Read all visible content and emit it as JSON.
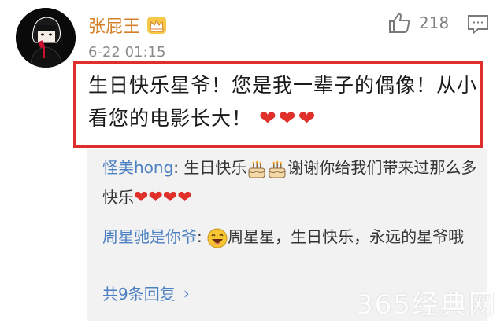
{
  "comment": {
    "username": "张屁王",
    "timestamp": "6-22 01:15",
    "like_count": "218",
    "text": "生日快乐星爷！您是我一辈子的偶像！从小看您的电影长大！",
    "hearts": [
      "❤",
      "❤",
      "❤"
    ]
  },
  "replies": [
    {
      "user": "怪美hong",
      "sep": ": ",
      "text_before": "生日快乐",
      "text_after": "谢谢你给我们带来过那么多快乐",
      "hearts": [
        "❤",
        "❤",
        "❤",
        "❤"
      ]
    },
    {
      "user": "周星驰是你爷",
      "sep": ": ",
      "text": "周星星，生日快乐，永远的星爷哦"
    }
  ],
  "more_replies": {
    "label": "共9条回复",
    "arrow": "›"
  },
  "watermark": "365经典网",
  "colors": {
    "username": "#d4802a",
    "link": "#4c80c2",
    "highlight": "#e02d2d",
    "heart": "#e0302a"
  }
}
